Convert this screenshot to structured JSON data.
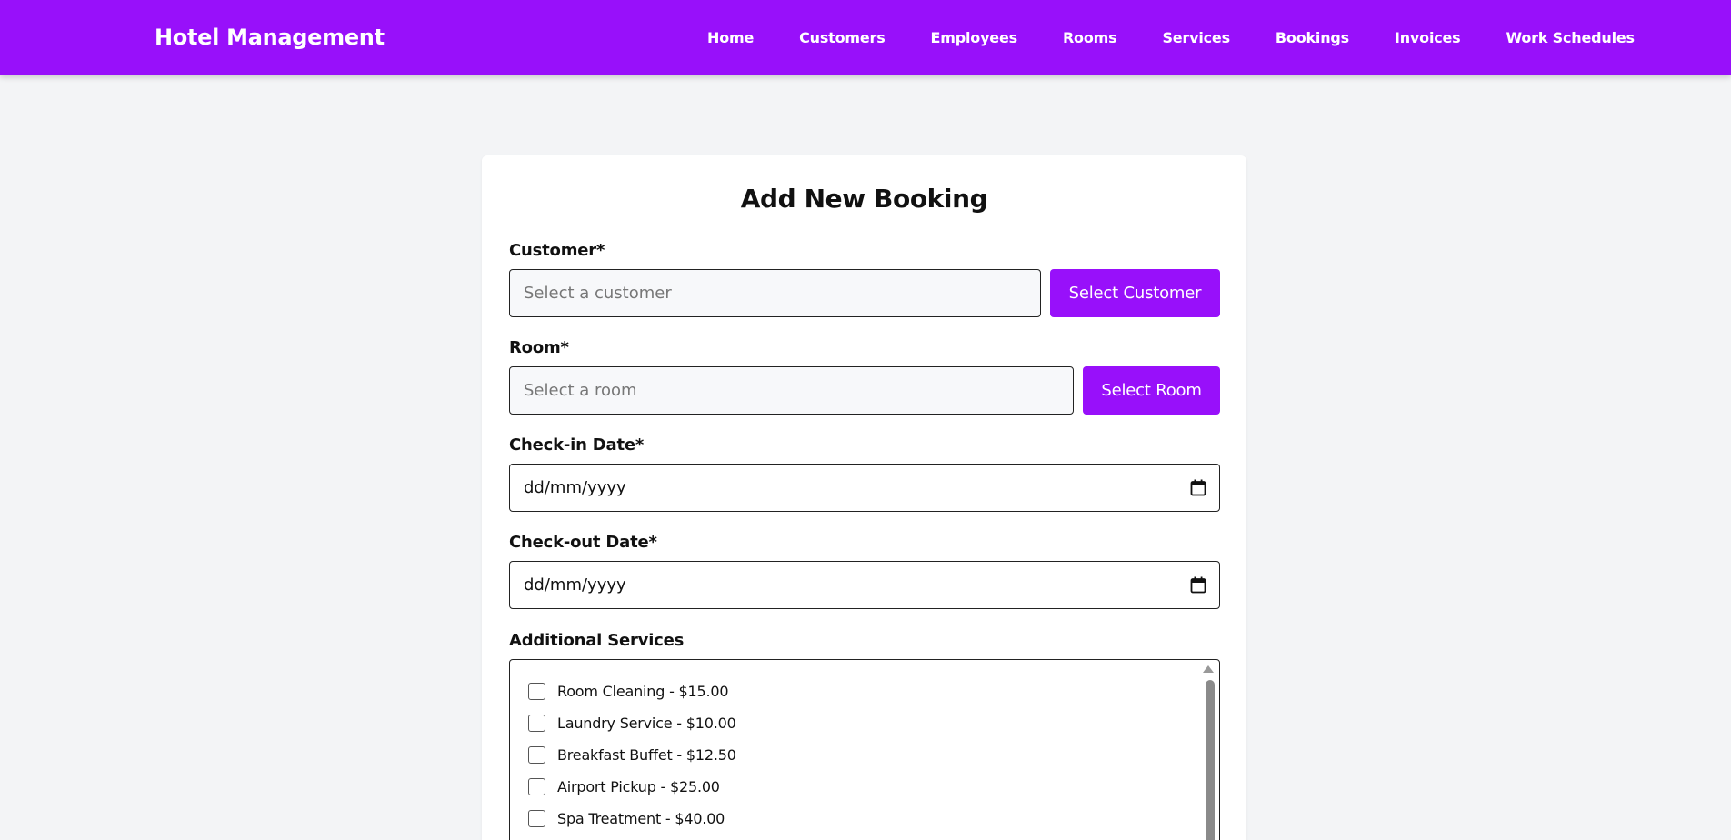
{
  "navbar": {
    "brand": "Hotel Management",
    "links": [
      "Home",
      "Customers",
      "Employees",
      "Rooms",
      "Services",
      "Bookings",
      "Invoices",
      "Work Schedules"
    ]
  },
  "form": {
    "title": "Add New Booking",
    "customer": {
      "label": "Customer*",
      "placeholder": "Select a customer",
      "button": "Select Customer"
    },
    "room": {
      "label": "Room*",
      "placeholder": "Select a room",
      "button": "Select Room"
    },
    "checkin": {
      "label": "Check-in Date*",
      "value": "dd/mm/yyyy"
    },
    "checkout": {
      "label": "Check-out Date*",
      "value": "dd/mm/yyyy"
    },
    "services": {
      "label": "Additional Services",
      "items": [
        "Room Cleaning - $15.00",
        "Laundry Service - $10.00",
        "Breakfast Buffet - $12.50",
        "Airport Pickup - $25.00",
        "Spa Treatment - $40.00"
      ]
    }
  },
  "colors": {
    "accent": "#9810fa",
    "background": "#f3f4f6"
  }
}
